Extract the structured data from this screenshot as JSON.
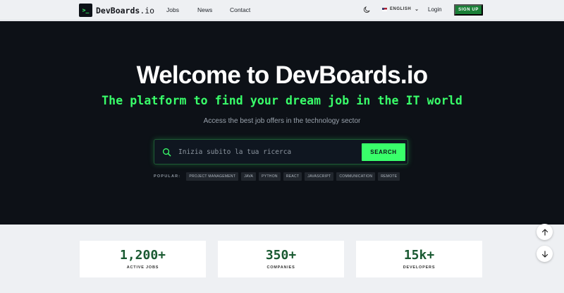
{
  "nav": {
    "logo_mark": ">_",
    "logo_name": "DevBoards",
    "logo_suffix": ".io",
    "links": [
      "Jobs",
      "News",
      "Contact"
    ],
    "theme_icon": "moon-icon",
    "language": "ENGLISH",
    "login": "Login",
    "signup": "SIGN UP"
  },
  "hero": {
    "title": "Welcome to DevBoards.io",
    "subtitle": "The platform to find your dream job in the IT world",
    "description": "Access the best job offers in the technology sector",
    "search_placeholder": "Inizia subito la tua ricerca",
    "search_button": "SEARCH",
    "popular_label": "POPULAR:",
    "tags": [
      "PROJECT MANAGEMENT",
      "JAVA",
      "PYTHON",
      "REACT",
      "JAVASCRIPT",
      "COMMUNICATION",
      "REMOTE"
    ]
  },
  "stats": [
    {
      "value": "1,200+",
      "label": "ACTIVE JOBS"
    },
    {
      "value": "350+",
      "label": "COMPANIES"
    },
    {
      "value": "15k+",
      "label": "DEVELOPERS"
    }
  ],
  "scroll": {
    "up_icon": "arrow-up-icon",
    "down_icon": "arrow-down-icon"
  },
  "colors": {
    "accent": "#39ff6a",
    "brand": "#1a7f37",
    "hero_bg": "#0d1117",
    "stat_value": "#1a5a32"
  }
}
